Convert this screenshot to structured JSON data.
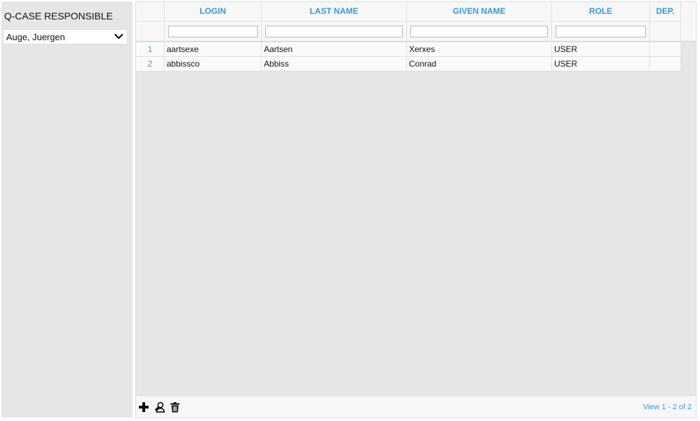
{
  "sidebar": {
    "title": "Q-CASE RESPONSIBLE",
    "selected_responsible": "Auge, Juergen"
  },
  "grid": {
    "columns": [
      {
        "key": "row",
        "label": ""
      },
      {
        "key": "login",
        "label": "LOGIN"
      },
      {
        "key": "last_name",
        "label": "LAST NAME"
      },
      {
        "key": "given_name",
        "label": "GIVEN NAME"
      },
      {
        "key": "role",
        "label": "ROLE"
      },
      {
        "key": "dep",
        "label": "DEP."
      }
    ],
    "filters": {
      "login": "",
      "last_name": "",
      "given_name": "",
      "role": ""
    },
    "rows": [
      {
        "num": "1",
        "login": "aartsexe",
        "last_name": "Aartsen",
        "given_name": "Xerxes",
        "role": "USER",
        "dep": ""
      },
      {
        "num": "2",
        "login": "abbissco",
        "last_name": "Abbiss",
        "given_name": "Conrad",
        "role": "USER",
        "dep": ""
      }
    ]
  },
  "footer": {
    "icons": [
      "add-icon",
      "user-search-icon",
      "trash-icon"
    ],
    "pager_text": "View 1 - 2 of 2"
  }
}
